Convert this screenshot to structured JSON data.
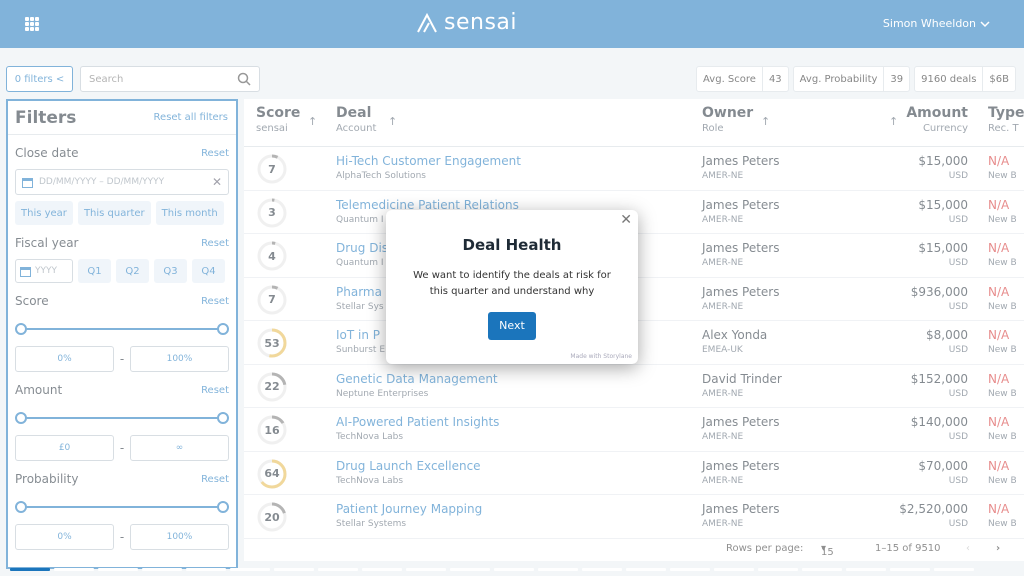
{
  "app": {
    "logo_text": "sensai",
    "user_name": "Simon Wheeldon"
  },
  "toolbar": {
    "filters_label": "0 filters <",
    "search_placeholder": "Search",
    "stats": [
      {
        "label": "Avg. Score",
        "value": "43"
      },
      {
        "label": "Avg. Probability",
        "value": "39"
      },
      {
        "label": "9160 deals",
        "value": "$6B"
      }
    ]
  },
  "filters": {
    "title": "Filters",
    "reset_all": "Reset all filters",
    "reset": "Reset",
    "close_date": {
      "title": "Close date",
      "placeholder": "DD/MM/YYYY – DD/MM/YYYY",
      "chips": [
        "This year",
        "This quarter",
        "This month"
      ]
    },
    "fiscal_year": {
      "title": "Fiscal year",
      "placeholder": "YYYY",
      "quarters": [
        "Q1",
        "Q2",
        "Q3",
        "Q4"
      ]
    },
    "score": {
      "title": "Score",
      "min": "0%",
      "max": "100%"
    },
    "amount": {
      "title": "Amount",
      "min": "£0",
      "max": "∞"
    },
    "probability": {
      "title": "Probability",
      "min": "0%",
      "max": "100%"
    }
  },
  "table": {
    "headers": {
      "score": "Score",
      "score_sub": "sensai",
      "deal": "Deal",
      "deal_sub": "Account",
      "owner": "Owner",
      "owner_sub": "Role",
      "amount": "Amount",
      "amount_sub": "Currency",
      "type": "Type",
      "type_sub": "Rec. T"
    },
    "rows": [
      {
        "score": "7",
        "score_pct": 7,
        "deal": "Hi-Tech Customer Engagement",
        "account": "AlphaTech Solutions",
        "owner": "James Peters",
        "role": "AMER-NE",
        "amount": "$15,000",
        "currency": "USD",
        "type": "N/A",
        "rec": "New B"
      },
      {
        "score": "3",
        "score_pct": 3,
        "deal": "Telemedicine Patient Relations",
        "account": "Quantum I",
        "owner": "James Peters",
        "role": "AMER-NE",
        "amount": "$15,000",
        "currency": "USD",
        "type": "N/A",
        "rec": "New B"
      },
      {
        "score": "4",
        "score_pct": 4,
        "deal": "Drug Dis",
        "account": "Quantum I",
        "owner": "James Peters",
        "role": "AMER-NE",
        "amount": "$15,000",
        "currency": "USD",
        "type": "N/A",
        "rec": "New B"
      },
      {
        "score": "7",
        "score_pct": 7,
        "deal": "Pharma",
        "account": "Stellar Sys",
        "owner": "James Peters",
        "role": "AMER-NE",
        "amount": "$936,000",
        "currency": "USD",
        "type": "N/A",
        "rec": "New B"
      },
      {
        "score": "53",
        "score_pct": 53,
        "deal": "IoT in P",
        "account": "Sunburst E",
        "owner": "Alex Yonda",
        "role": "EMEA-UK",
        "amount": "$8,000",
        "currency": "USD",
        "type": "N/A",
        "rec": "New B"
      },
      {
        "score": "22",
        "score_pct": 22,
        "deal": "Genetic Data Management",
        "account": "Neptune Enterprises",
        "owner": "David Trinder",
        "role": "AMER-NE",
        "amount": "$152,000",
        "currency": "USD",
        "type": "N/A",
        "rec": "New B"
      },
      {
        "score": "16",
        "score_pct": 16,
        "deal": "AI-Powered Patient Insights",
        "account": "TechNova Labs",
        "owner": "James Peters",
        "role": "AMER-NE",
        "amount": "$140,000",
        "currency": "USD",
        "type": "N/A",
        "rec": "New B"
      },
      {
        "score": "64",
        "score_pct": 64,
        "deal": "Drug Launch Excellence",
        "account": "TechNova Labs",
        "owner": "James Peters",
        "role": "AMER-NE",
        "amount": "$70,000",
        "currency": "USD",
        "type": "N/A",
        "rec": "New B"
      },
      {
        "score": "20",
        "score_pct": 20,
        "deal": "Patient Journey Mapping",
        "account": "Stellar Systems",
        "owner": "James Peters",
        "role": "AMER-NE",
        "amount": "$2,520,000",
        "currency": "USD",
        "type": "N/A",
        "rec": "New B"
      }
    ]
  },
  "pager": {
    "rows_label": "Rows per page:",
    "rows_value": "15",
    "range": "1–15 of 9510"
  },
  "modal": {
    "title": "Deal Health",
    "body": "We want to identify the deals at risk for this quarter and understand why",
    "button": "Next",
    "footer": "Made with Storylane"
  },
  "colors": {
    "brand": "#1b75bc",
    "danger": "#d32f2f",
    "score_high": "#e6b84a",
    "score_low": "#777777"
  }
}
